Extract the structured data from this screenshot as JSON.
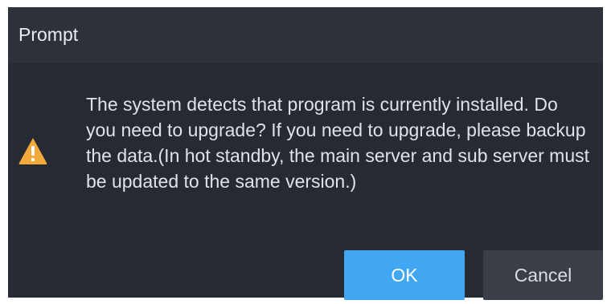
{
  "dialog": {
    "title": "Prompt",
    "message": "The system detects that program is currently installed. Do you need to upgrade? If you need to upgrade, please backup the data.(In hot standby, the main server and sub server must be updated to the same version.)",
    "icon": "warning-icon",
    "ok_label": "OK",
    "cancel_label": "Cancel"
  },
  "colors": {
    "dialog_bg": "#252a33",
    "titlebar_bg": "#2c313a",
    "ok_bg": "#42a7f2",
    "cancel_bg": "#3a3f47",
    "warning": "#f2a83a"
  }
}
